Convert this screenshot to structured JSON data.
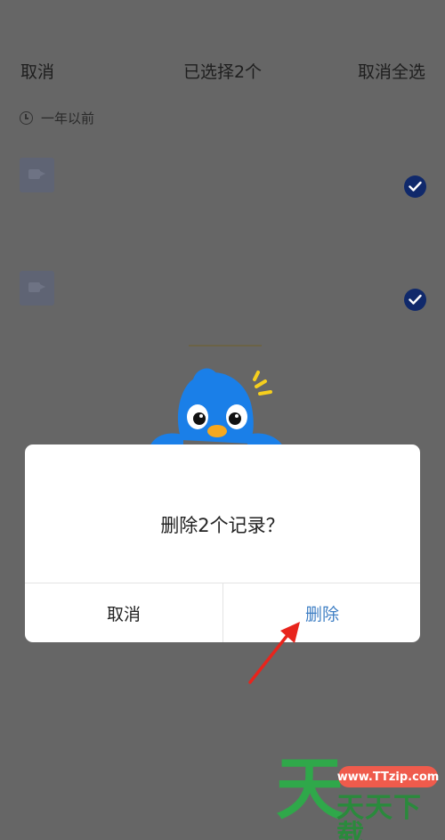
{
  "header": {
    "cancel_label": "取消",
    "title": "已选择2个",
    "deselect_all_label": "取消全选"
  },
  "section": {
    "label": "一年以前",
    "icon": "clock-icon"
  },
  "items": [
    {
      "thumb_icon": "video-camera-icon",
      "selected": true
    },
    {
      "thumb_icon": "video-camera-icon",
      "selected": true
    }
  ],
  "dialog": {
    "message": "删除2个记录？",
    "cancel_label": "取消",
    "delete_label": "删除"
  },
  "watermark": {
    "big": "天",
    "url": "www.TTzip.com",
    "small": "天天下载"
  },
  "colors": {
    "overlay": "#666666",
    "check": "#10296b",
    "delete_text": "#3f7fc4",
    "mascot_blue": "#1a7fe8",
    "arrow": "#e8241c",
    "watermark_green": "#2fa84a"
  }
}
